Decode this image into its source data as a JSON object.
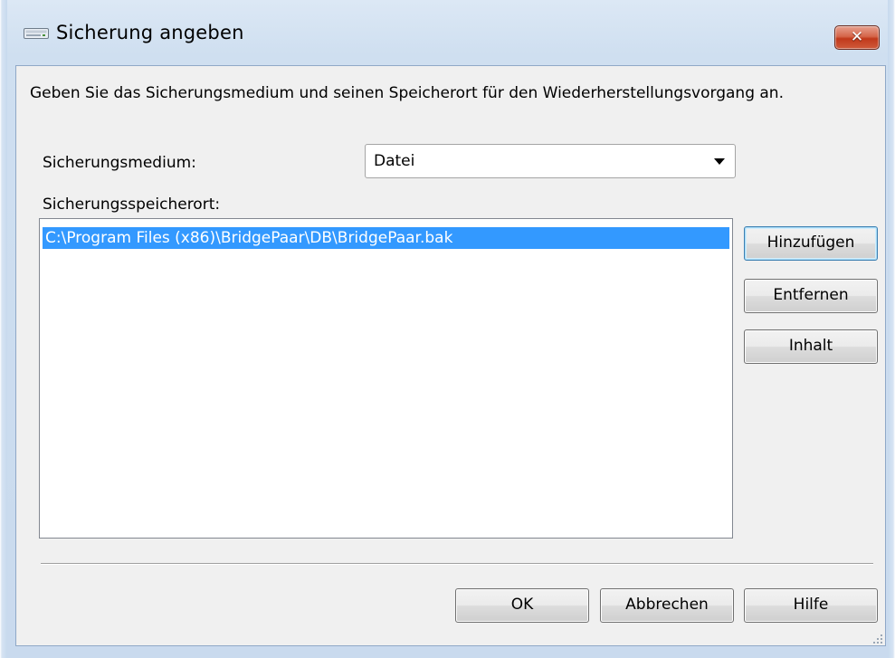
{
  "window": {
    "title": "Sicherung angeben",
    "close_glyph": "✕",
    "icon": "backup-device-icon"
  },
  "description": "Geben Sie das Sicherungsmedium und seinen Speicherort für den Wiederherstellungsvorgang an.",
  "backup_media": {
    "label": "Sicherungsmedium:",
    "selected": "Datei"
  },
  "backup_location": {
    "label": "Sicherungsspeicherort:",
    "items": [
      "C:\\Program Files (x86)\\BridgePaar\\DB\\BridgePaar.bak"
    ],
    "selected_index": 0
  },
  "side_buttons": {
    "add": "Hinzufügen",
    "remove": "Entfernen",
    "contents": "Inhalt"
  },
  "footer_buttons": {
    "ok": "OK",
    "cancel": "Abbrechen",
    "help": "Hilfe"
  },
  "colors": {
    "selection": "#3399ff",
    "close_button": "#c1391b",
    "frame": "#c9daee"
  }
}
